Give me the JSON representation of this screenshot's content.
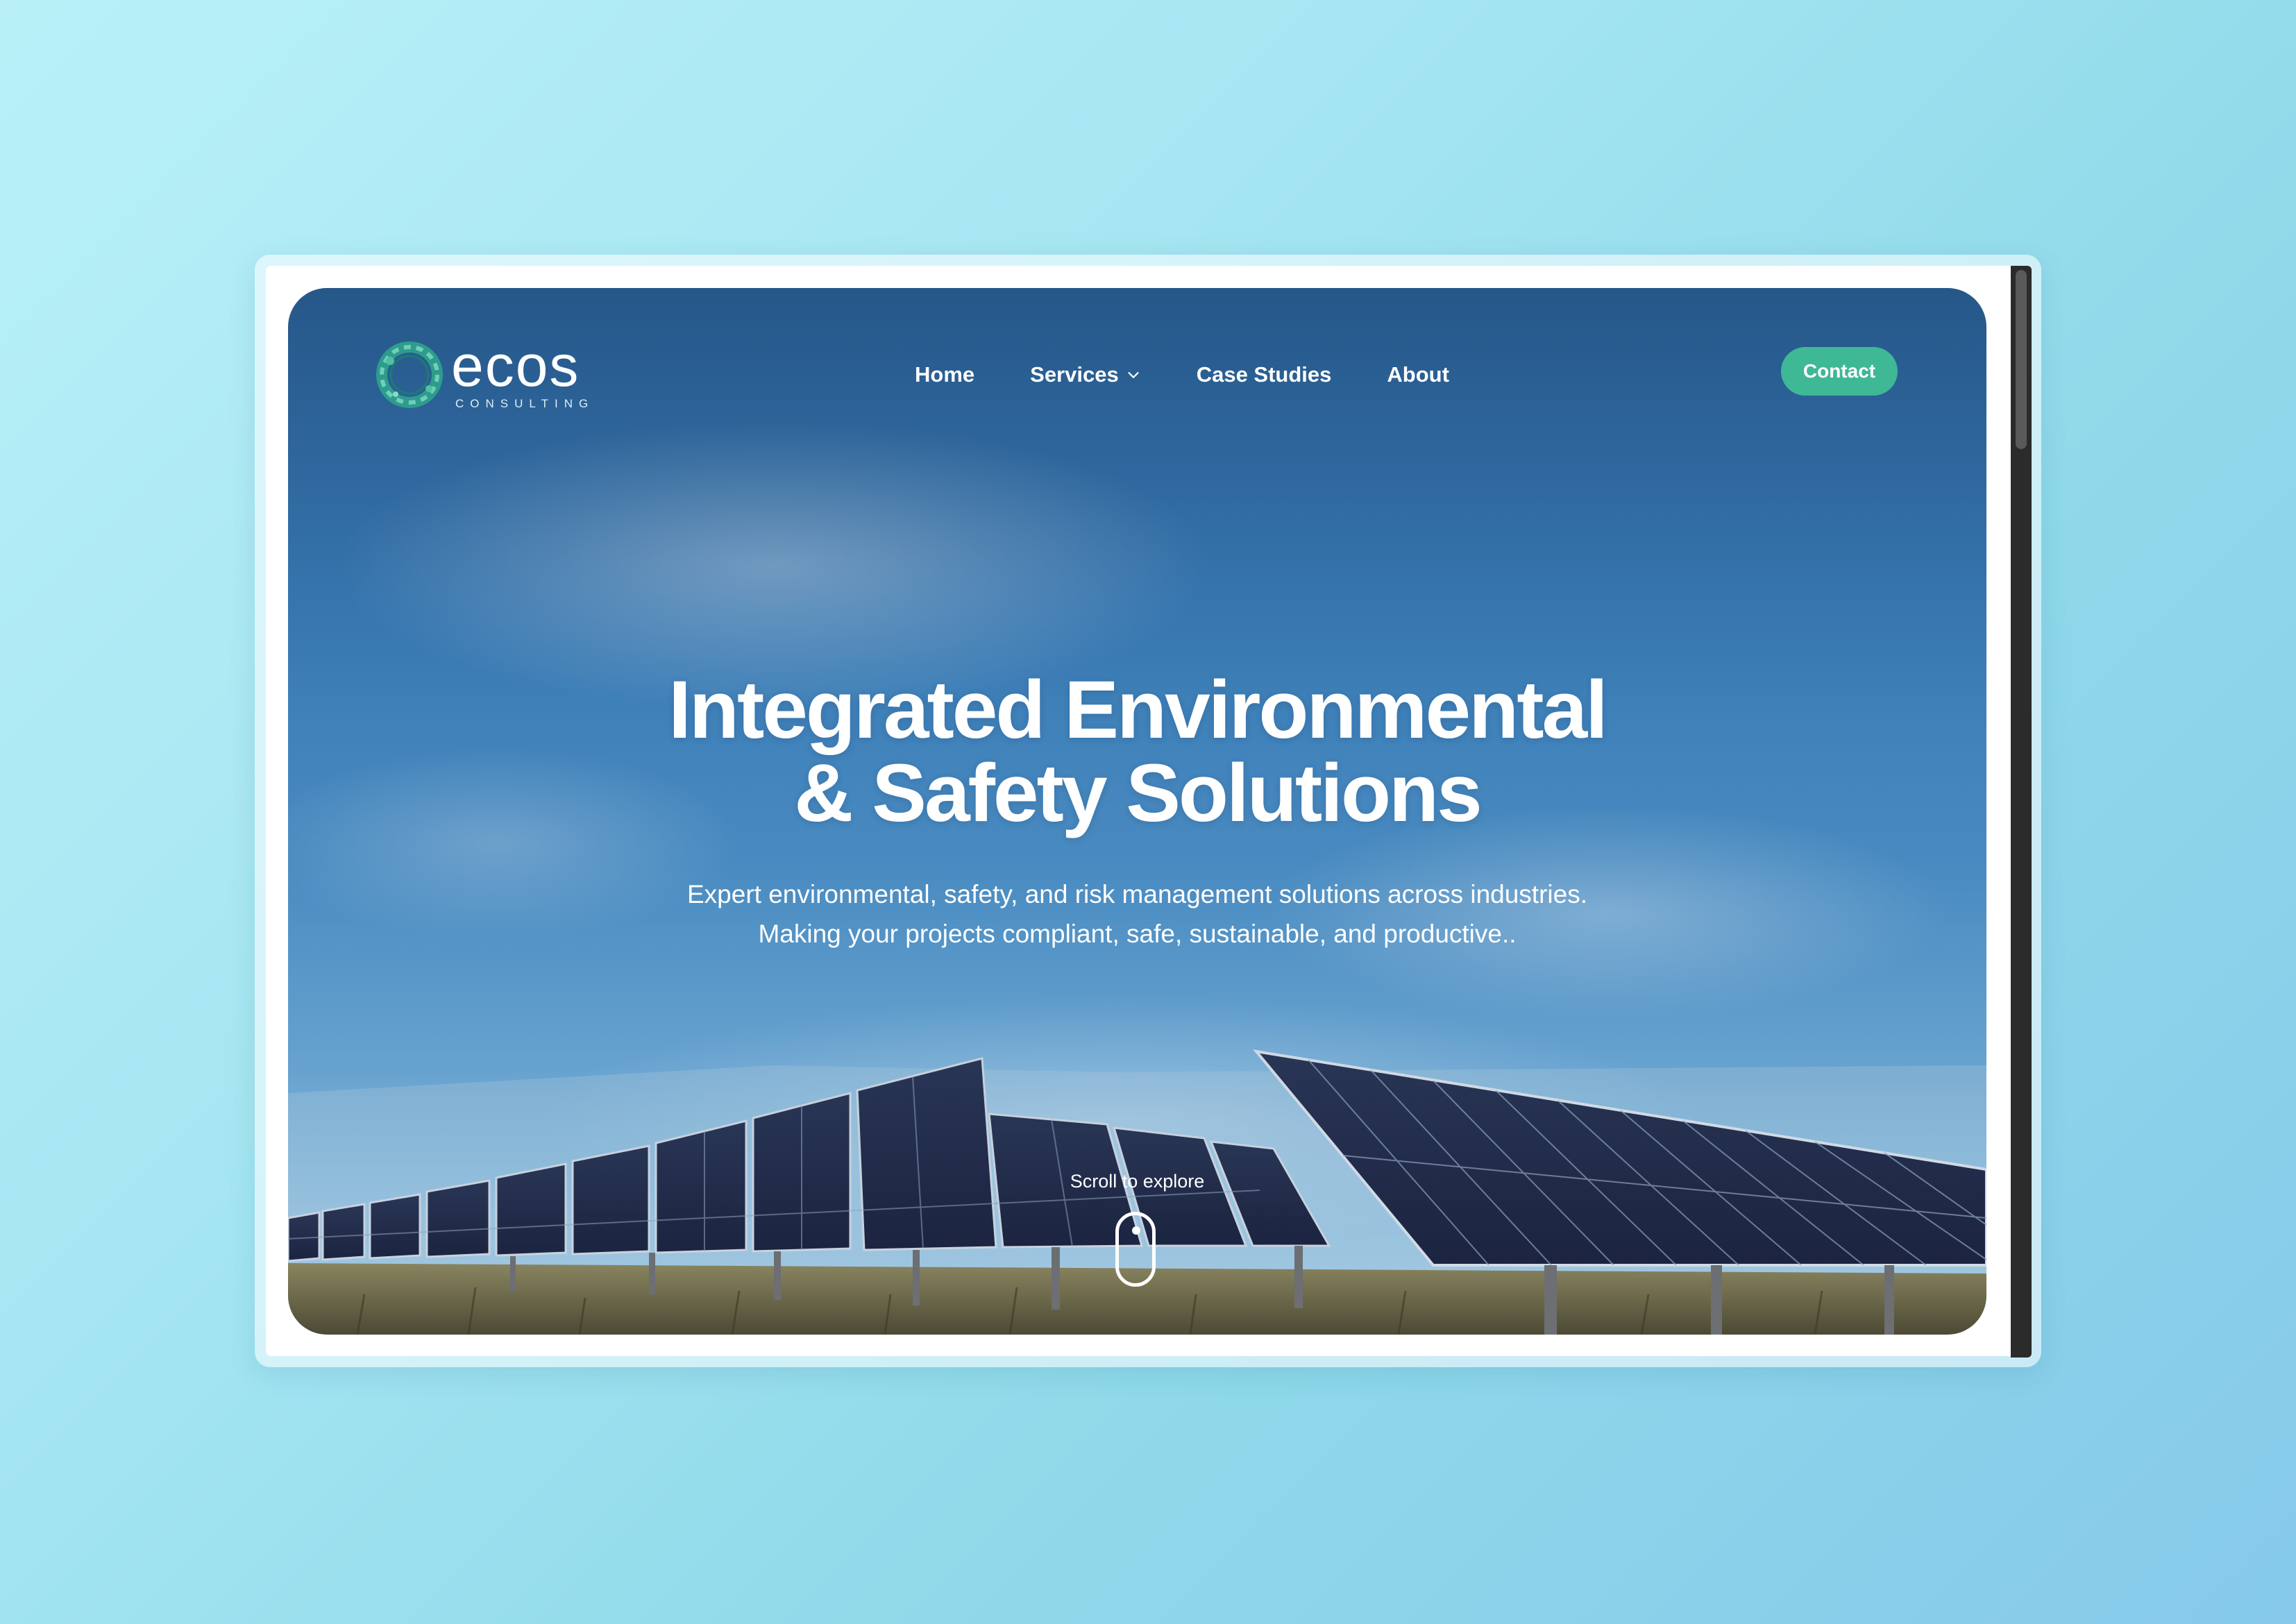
{
  "brand": {
    "name": "ecos",
    "tagline": "CONSULTING",
    "accent_color": "#3fb895"
  },
  "nav": {
    "items": [
      {
        "label": "Home"
      },
      {
        "label": "Services",
        "icon": "chevron-down-icon"
      },
      {
        "label": "Case Studies"
      },
      {
        "label": "About"
      }
    ],
    "contact_label": "Contact"
  },
  "hero": {
    "headline_line1": "Integrated Environmental",
    "headline_line2": "& Safety Solutions",
    "subtext_line1": "Expert environmental, safety, and risk management solutions across industries.",
    "subtext_line2": "Making your projects compliant, safe, sustainable, and productive..",
    "scroll_label": "Scroll to explore",
    "background": "solar-panel-field-under-blue-sky"
  }
}
